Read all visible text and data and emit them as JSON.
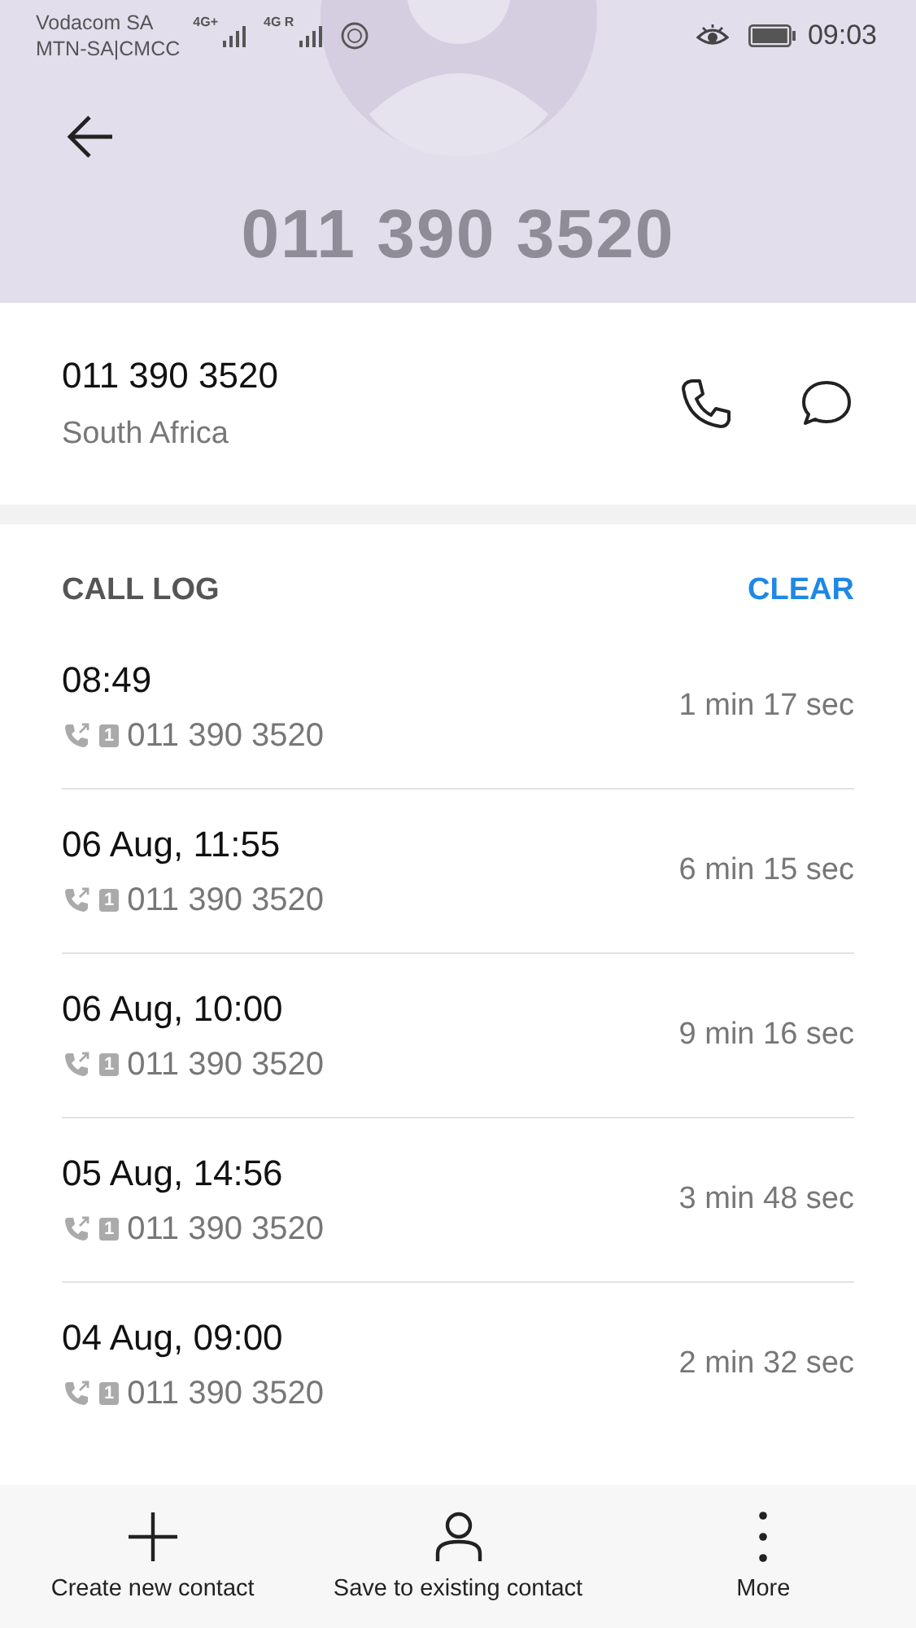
{
  "status_bar": {
    "carrier_1": "Vodacom SA",
    "carrier_2": "MTN-SA|CMCC",
    "network_1": "4G+",
    "network_2": "4G R",
    "time": "09:03"
  },
  "header": {
    "title": "011 390 3520"
  },
  "contact": {
    "number": "011 390 3520",
    "location": "South Africa"
  },
  "call_log": {
    "title": "CALL LOG",
    "clear": "CLEAR",
    "entries": [
      {
        "time": "08:49",
        "sim": "1",
        "number": "011 390 3520",
        "duration": "1 min 17 sec"
      },
      {
        "time": "06 Aug, 11:55",
        "sim": "1",
        "number": "011 390 3520",
        "duration": "6 min 15 sec"
      },
      {
        "time": "06 Aug, 10:00",
        "sim": "1",
        "number": "011 390 3520",
        "duration": "9 min 16 sec"
      },
      {
        "time": "05 Aug, 14:56",
        "sim": "1",
        "number": "011 390 3520",
        "duration": "3 min 48 sec"
      },
      {
        "time": "04 Aug, 09:00",
        "sim": "1",
        "number": "011 390 3520",
        "duration": "2 min 32 sec"
      }
    ]
  },
  "bottom_bar": [
    {
      "kind": "plus",
      "label": "Create new contact"
    },
    {
      "kind": "person",
      "label": "Save to existing contact"
    },
    {
      "kind": "more",
      "label": "More"
    }
  ]
}
